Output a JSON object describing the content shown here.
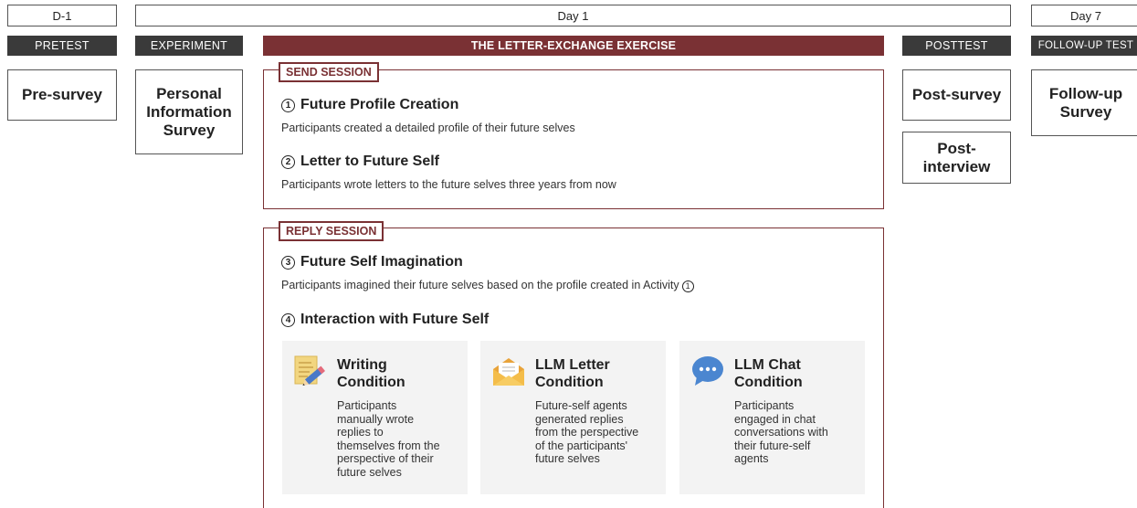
{
  "timeline": {
    "d_minus_1": "D-1",
    "day1": "Day 1",
    "day7": "Day 7"
  },
  "phases": {
    "pretest": "PRETEST",
    "experiment": "EXPERIMENT",
    "exercise": "THE LETTER-EXCHANGE EXERCISE",
    "posttest": "POSTTEST",
    "followup": "FOLLOW-UP TEST"
  },
  "boxes": {
    "pre_survey": "Pre-survey",
    "personal_info_survey": "Personal\nInformation\nSurvey",
    "post_survey": "Post-survey",
    "post_interview": "Post-\ninterview",
    "followup_survey": "Follow-up\nSurvey"
  },
  "send_session": {
    "tag": "SEND SESSION",
    "activity1": {
      "num": "1",
      "title": "Future Profile Creation",
      "desc": "Participants created a detailed profile of their future selves"
    },
    "activity2": {
      "num": "2",
      "title": "Letter to Future Self",
      "desc": "Participants wrote letters to the future selves three years from now"
    }
  },
  "reply_session": {
    "tag": "REPLY SESSION",
    "activity3": {
      "num": "3",
      "title": "Future Self Imagination",
      "desc": "Participants imagined their future selves based on the profile created in Activity",
      "ref_num": "1"
    },
    "activity4": {
      "num": "4",
      "title": "Interaction with Future Self"
    }
  },
  "conditions": [
    {
      "icon": "writing-pencil-icon",
      "title": "Writing\nCondition",
      "desc": "Participants\nmanually wrote\nreplies to\nthemselves from the\nperspective of their\nfuture selves"
    },
    {
      "icon": "envelope-letter-icon",
      "title": "LLM Letter\nCondition",
      "desc": "Future-self agents\ngenerated replies\nfrom the perspective\nof the participants'\nfuture selves"
    },
    {
      "icon": "chat-bubble-icon",
      "title": "LLM Chat\nCondition",
      "desc": "Participants\nengaged in chat\nconversations with\ntheir future-self\nagents"
    }
  ],
  "colors": {
    "accent": "#7a3134",
    "phase_dark": "#3a3a3a",
    "card_bg": "#f3f3f3"
  }
}
